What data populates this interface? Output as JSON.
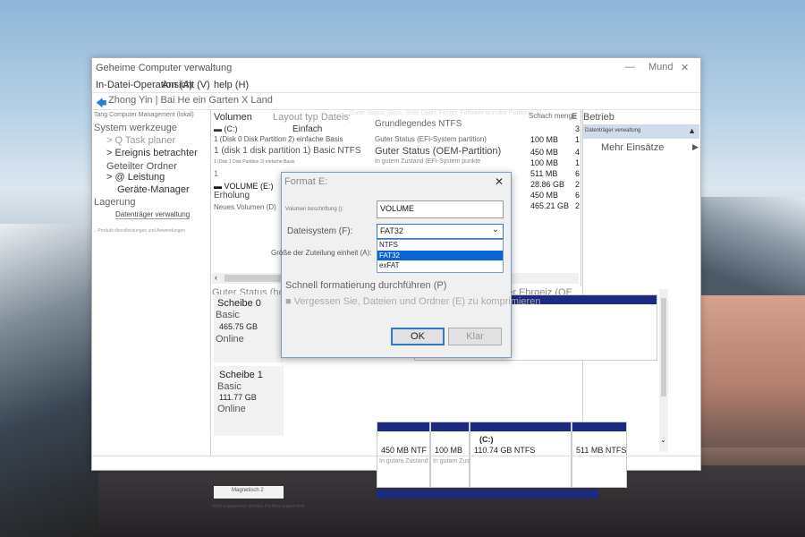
{
  "window": {
    "title": "Geheime Computer verwaltung",
    "title_right": "Mund",
    "close": "✕",
    "minimize": "—"
  },
  "menu": {
    "file": "In-Datei-Operation (A)",
    "view": "Ansicht (V)",
    "help": "help (H)"
  },
  "toolbar": {
    "back_icon": "arrow-left-icon",
    "text": "Zhong Yin | Bai He ein Garten X Land"
  },
  "tree": {
    "root": "Tang Computer Management (lokal)",
    "system_tools": "System werkzeuge",
    "task_scheduler": "> Q Task planer",
    "event_viewer": "> Ereignis betrachter",
    "shared_folders": "Geteilter Ordner",
    "performance": "> @ Leistung",
    "device_manager": "Geräte-Manager",
    "storage": "Lagerung",
    "disk_management": "Datenträger verwaltung",
    "services": "→ Produkt dienstleistungen und Anwendungen"
  },
  "list": {
    "headers": {
      "volume": "Volumen",
      "layout": "Layout typ Dateisystems tatus",
      "capacity": "Schach menge",
      "free": "E"
    },
    "rows": [
      {
        "name": "(C:)",
        "layout": "Einfach",
        "fs": "Grundlegendes NTFS",
        "status": "Guter Status (Boot, Seite Datei, Fehler, Follower-primäre Partition) 110,74 GB",
        "size": "",
        "free": "3"
      },
      {
        "name": "1 (Disk 0 Disk Partition 2) einfache Basis",
        "status": "Guter Status (EFI-System partition)",
        "size": "100 MB",
        "free": "1"
      },
      {
        "name": "1 (disk 1 disk partition 1) Basic NTFS",
        "status": "Guter Status (OEM-Partition)",
        "size": "450 MB",
        "free": "4"
      },
      {
        "name": "1 (Disk 1 Disk Partition 2) einfache Basis",
        "status": "In gutem Zustand (EFI-System punkte",
        "size": "100 MB",
        "free": "1"
      },
      {
        "name": "1",
        "status": "",
        "size": "511 MB",
        "free": "6"
      },
      {
        "name": "VOLUME (E:)",
        "status": "",
        "size": "28.86 GB",
        "free": "2"
      },
      {
        "name": "Erholung",
        "status": "",
        "size": "450 MB",
        "free": "6"
      },
      {
        "name": "Neues Volumen (D)",
        "status": "",
        "size": "465.21 GB",
        "free": "2"
      }
    ]
  },
  "actions": {
    "title": "Betrieb",
    "section": "Datenträger verwaltung",
    "more": "Mehr Einsätze",
    "collapse_icon": "triangle-up-icon",
    "expand_icon": "triangle-right-icon"
  },
  "disks": {
    "disk0": {
      "name": "Scheibe 0",
      "type": "Basic",
      "size": "465.75 GB",
      "status": "Online"
    },
    "disk1": {
      "name": "Scheibe 1",
      "type": "Basic",
      "size": "111.77 GB",
      "status": "Online"
    },
    "disk2": {
      "name": "Magnetisch 2"
    },
    "disk1_parts": [
      {
        "size": "450 MB NTF",
        "status": "In gutam Zustand"
      },
      {
        "size": "100 MB",
        "status": "In gutam Zustand"
      },
      {
        "label": "(C:)",
        "size": "110.74 GB NTFS",
        "status": "Guter Status (hohe Bewegung, Seiten datei, guter keimlings ähnlicher Ehrgeiz (OE"
      },
      {
        "size": "511 MB NTFS",
        "status": ""
      }
    ],
    "legend": "Nicht zugewiesen   primäre Partition zugeordnet"
  },
  "dialog": {
    "title": "Format E:",
    "close": "✕",
    "label_volume": "Volumen beschriftung ():",
    "volume_value": "VOLUME",
    "label_fs": "Dateisystem (F):",
    "fs_selected": "FAT32",
    "fs_options": [
      "NTFS",
      "FAT32",
      "exFAT"
    ],
    "label_cluster": "Größe der Zuteilung einheit (A):",
    "quick_format": "Schnell formatierung durchführen (P)",
    "compress": "Vergessen Sie, Dateien und Ordner (E) zu komprimieren",
    "ok": "OK",
    "cancel": "Klar"
  }
}
